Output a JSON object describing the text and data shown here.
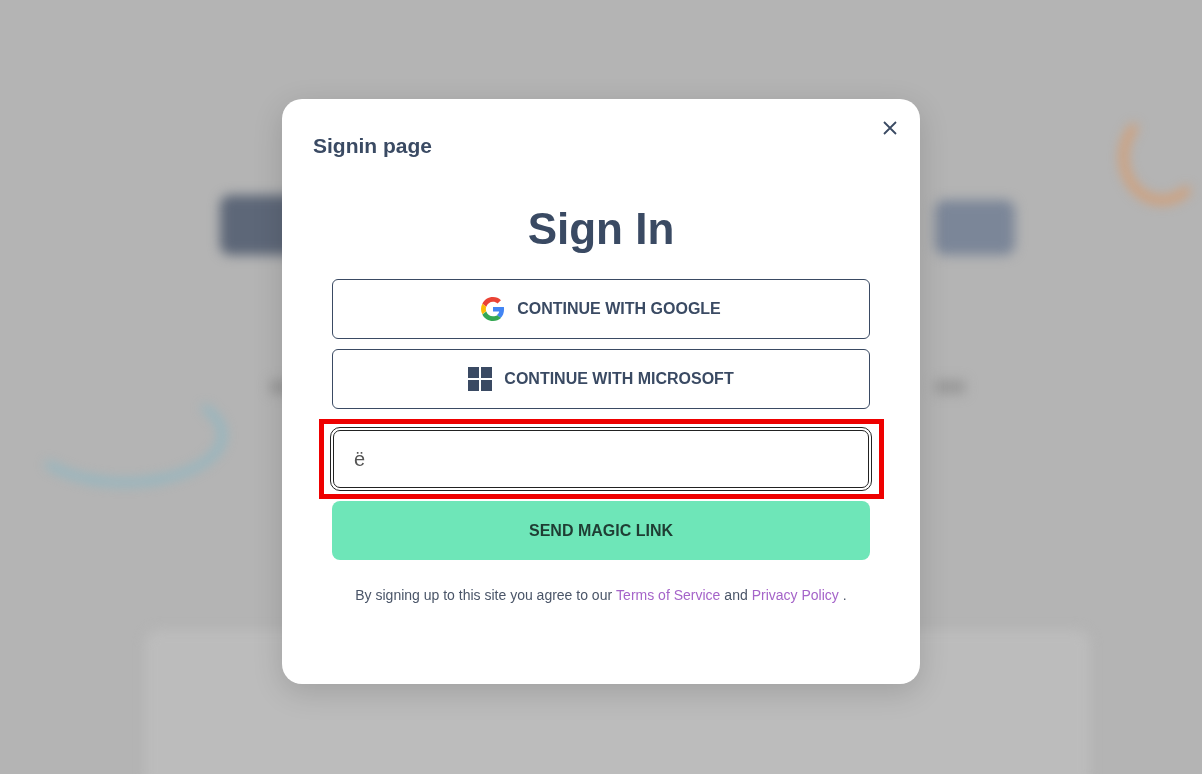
{
  "dialog": {
    "title": "Signin page",
    "heading": "Sign In",
    "providers": [
      {
        "kind": "google",
        "label": "CONTINUE WITH GOOGLE"
      },
      {
        "kind": "microsoft",
        "label": "CONTINUE WITH MICROSOFT"
      }
    ],
    "email_field": {
      "value": "ë",
      "highlighted": true
    },
    "submit_button": "SEND MAGIC LINK",
    "legal": {
      "before": "By signing up to this site you agree to our",
      "terms_link": "Terms of Service",
      "middle": "and",
      "privacy_link": "Privacy Policy",
      "after": "."
    }
  }
}
